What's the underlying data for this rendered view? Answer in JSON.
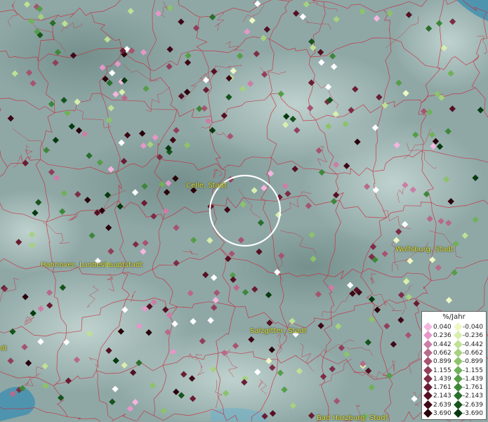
{
  "cities": [
    {
      "name": "Celle, Stadt",
      "label": "Celle, Stadt"
    },
    {
      "name": "Hannover, Landeshauptstadt",
      "label": "Hannover, Landeshauptstadt"
    },
    {
      "name": "Wolfsburg, Stadt",
      "label": "Wolfsburg, Stadt"
    },
    {
      "name": "Salzgitter, Stadt",
      "label": "Salzgitter, Stadt"
    },
    {
      "name": "Bad Harzburg, Stadt",
      "label": "Bad Harzburg, Stadt"
    },
    {
      "name": "edge-left",
      "label": "dt"
    }
  ],
  "legend": {
    "unit": "%/Jahr",
    "positive": [
      "0.040",
      "0.236",
      "0.442",
      "0.662",
      "0.899",
      "1.155",
      "1.439",
      "1.761",
      "2.143",
      "2.639",
      "3.690"
    ],
    "negative": [
      "-0.040",
      "-0.236",
      "-0.442",
      "-0.662",
      "-0.899",
      "-1.155",
      "-1.439",
      "-1.761",
      "-2.143",
      "-2.639",
      "-3.690"
    ],
    "positive_colors": [
      "#f4b6e0",
      "#e597c8",
      "#cc7ea6",
      "#b86a8a",
      "#a65470",
      "#913f5a",
      "#7d2d45",
      "#691d33",
      "#551123",
      "#3f0816",
      "#2a020b"
    ],
    "negative_colors": [
      "#eef8c4",
      "#d8eeae",
      "#bfe095",
      "#a6d17f",
      "#8cc36a",
      "#6fb159",
      "#559d49",
      "#3e873a",
      "#2a6e2c",
      "#17541d",
      "#073a10"
    ]
  },
  "colors": {
    "terrain": "#8fa8a6",
    "borders": "#c8283a",
    "selection_ring": "#ffffff"
  }
}
